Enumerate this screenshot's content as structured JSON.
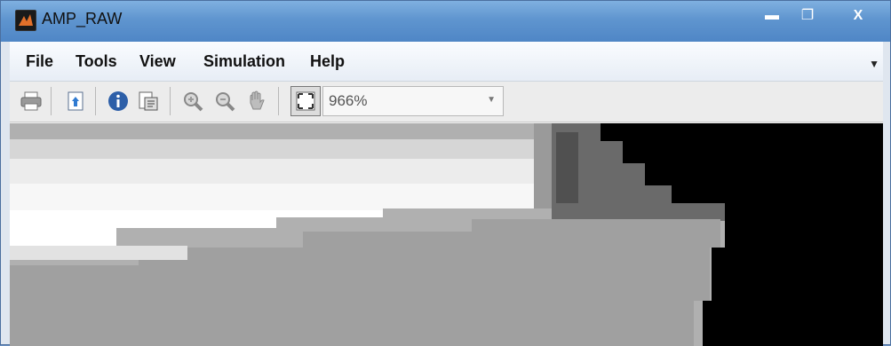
{
  "window": {
    "title": "AMP_RAW",
    "minimize_glyph": "▬",
    "maximize_glyph": "❐",
    "close_glyph": "X"
  },
  "menu": {
    "items": [
      "File",
      "Tools",
      "View",
      "Simulation",
      "Help"
    ],
    "overflow_glyph": "▼"
  },
  "toolbar": {
    "icons": [
      "print-icon",
      "export-icon",
      "info-icon",
      "properties-icon",
      "zoom-in-icon",
      "zoom-out-icon",
      "pan-hand-icon",
      "fit-to-view-icon"
    ],
    "zoom_level": "966%",
    "zoom_dropdown_glyph": "▼"
  },
  "canvas": {
    "content": "magnified grayscale raw image",
    "background": "#000000"
  }
}
